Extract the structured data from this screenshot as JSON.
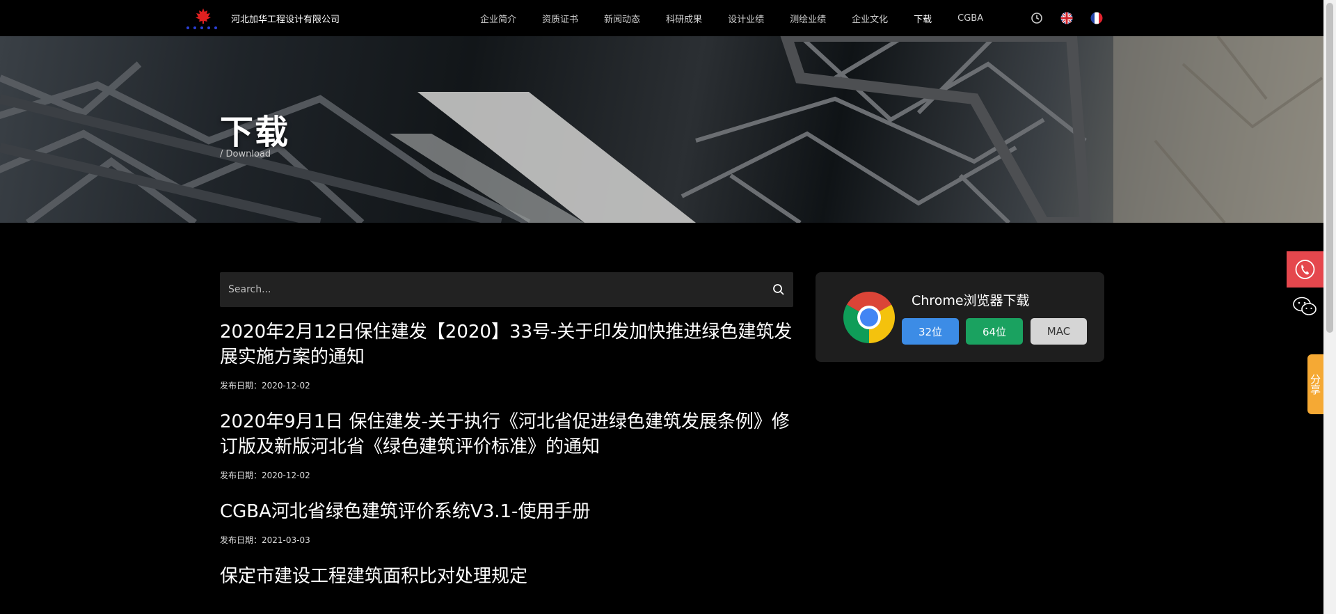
{
  "header": {
    "company_name": "河北加华工程设计有限公司",
    "logo_icon": "maple-leaf-stars-logo",
    "nav": [
      {
        "label": "企业简介",
        "active": false
      },
      {
        "label": "资质证书",
        "active": false
      },
      {
        "label": "新闻动态",
        "active": false
      },
      {
        "label": "科研成果",
        "active": false
      },
      {
        "label": "设计业绩",
        "active": false
      },
      {
        "label": "测绘业绩",
        "active": false
      },
      {
        "label": "企业文化",
        "active": false
      },
      {
        "label": "下载",
        "active": true
      },
      {
        "label": "CGBA",
        "active": false
      }
    ],
    "icons": [
      "clock-icon",
      "uk-flag-icon",
      "france-flag-icon"
    ]
  },
  "banner": {
    "title": "下载",
    "subtitle": "/ Download"
  },
  "search": {
    "placeholder": "Search...",
    "value": ""
  },
  "articles": [
    {
      "title": "2020年2月12日保住建发【2020】33号-关于印发加快推进绿色建筑发展实施方案的通知",
      "date": "发布日期：2020-12-02"
    },
    {
      "title": "2020年9月1日 保住建发-关于执行《河北省促进绿色建筑发展条例》修订版及新版河北省《绿色建筑评价标准》的通知",
      "date": "发布日期：2020-12-02"
    },
    {
      "title": "CGBA河北省绿色建筑评价系统V3.1-使用手册",
      "date": "发布日期：2021-03-03"
    },
    {
      "title": "保定市建设工程建筑面积比对处理规定",
      "date": ""
    }
  ],
  "chrome_card": {
    "title": "Chrome浏览器下载",
    "btn_32": "32位",
    "btn_64": "64位",
    "btn_mac": "MAC",
    "colors": {
      "btn_32": "#3c8ce6",
      "btn_64": "#1aa260",
      "btn_mac": "#d5d5d5"
    }
  },
  "side": {
    "share_label": "分享",
    "colors": {
      "phone": "#e5474d",
      "share": "#f5a934"
    }
  }
}
